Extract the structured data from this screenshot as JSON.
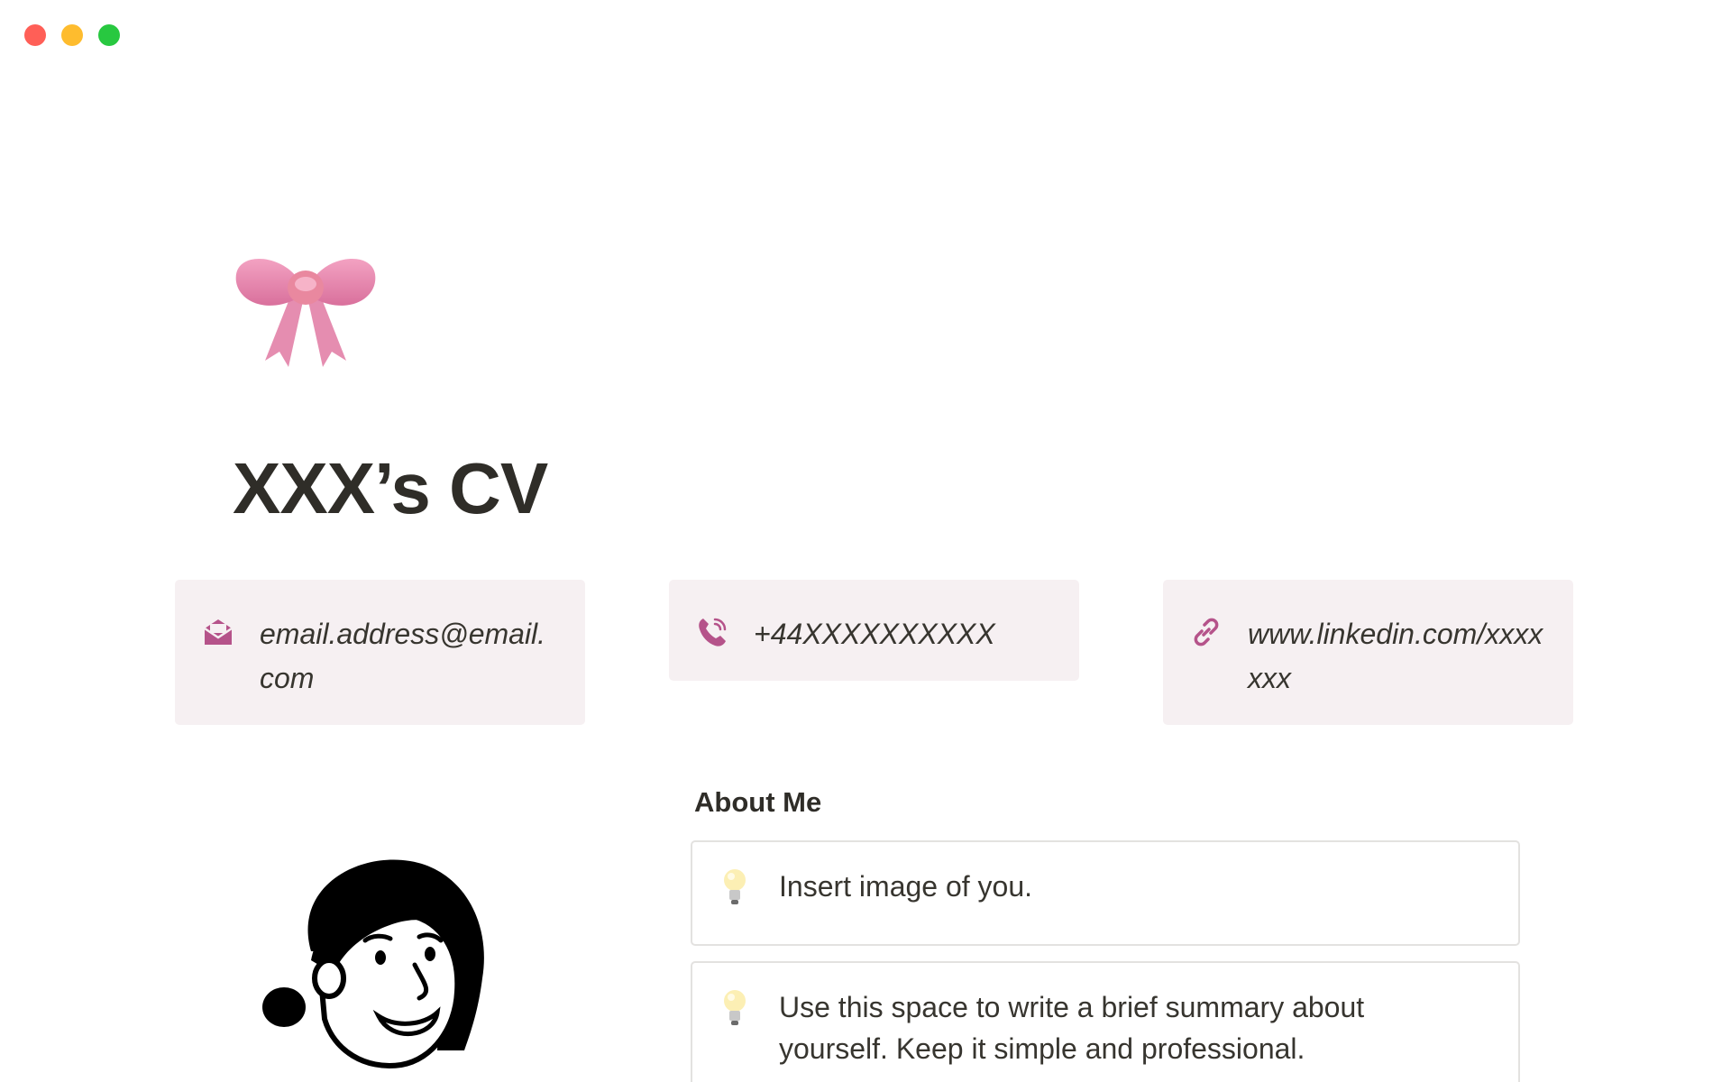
{
  "window": {
    "controls": [
      "close",
      "minimize",
      "maximize"
    ]
  },
  "page": {
    "icon": "ribbon-bow-icon",
    "title": "XXX’s CV"
  },
  "contacts": {
    "email": {
      "icon": "envelope-icon",
      "text": "email.address@email.com"
    },
    "phone": {
      "icon": "phone-icon",
      "text": "+44XXXXXXXXXX"
    },
    "link": {
      "icon": "link-icon",
      "text": "www.linkedin.com/xxxxxxx"
    }
  },
  "portrait": {
    "icon": "person-portrait-illustration"
  },
  "about": {
    "heading": "About Me",
    "callouts": [
      {
        "icon": "lightbulb-icon",
        "text": "Insert image of you."
      },
      {
        "icon": "lightbulb-icon",
        "text": "Use this space to write a brief summary about yourself. Keep it simple and professional."
      }
    ]
  },
  "colors": {
    "card_background": "#f6f0f2",
    "accent": "#b5538a",
    "bow": "#e07fa6",
    "text": "#37352f"
  }
}
